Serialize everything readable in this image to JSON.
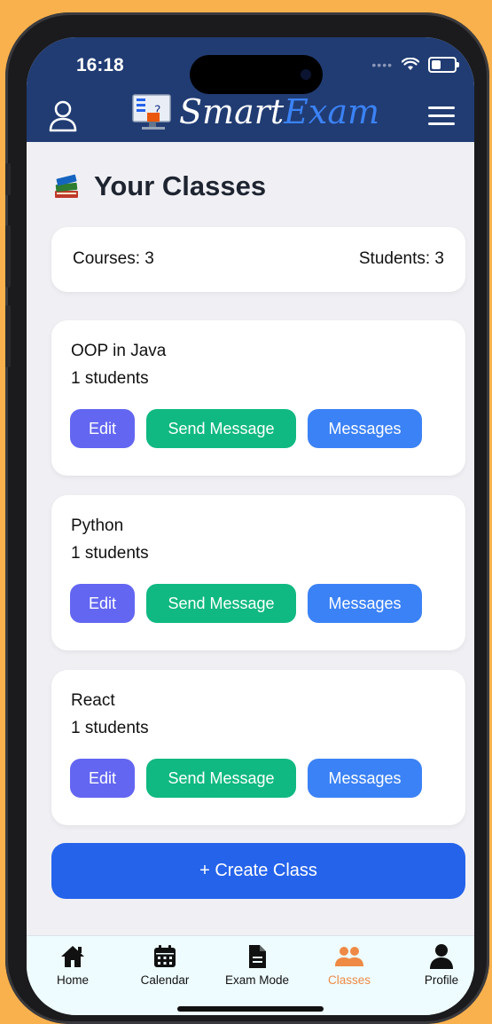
{
  "status_bar": {
    "time": "16:18"
  },
  "header": {
    "logo_primary": "Smart",
    "logo_secondary": "Exam",
    "user_icon": "user-icon",
    "menu_icon": "hamburger-menu-icon"
  },
  "page": {
    "title": "Your Classes",
    "title_icon": "books-icon"
  },
  "stats": {
    "courses": "Courses: 3",
    "students": "Students: 3"
  },
  "classes": [
    {
      "name": "OOP in Java",
      "count": "1 students",
      "edit": "Edit",
      "send": "Send Message",
      "messages": "Messages"
    },
    {
      "name": "Python",
      "count": "1 students",
      "edit": "Edit",
      "send": "Send Message",
      "messages": "Messages"
    },
    {
      "name": "React",
      "count": "1 students",
      "edit": "Edit",
      "send": "Send Message",
      "messages": "Messages"
    }
  ],
  "create_button": "+ Create Class",
  "tabs": [
    {
      "label": "Home",
      "icon": "home-icon"
    },
    {
      "label": "Calendar",
      "icon": "calendar-icon"
    },
    {
      "label": "Exam Mode",
      "icon": "document-icon"
    },
    {
      "label": "Classes",
      "icon": "group-icon",
      "active": true
    },
    {
      "label": "Profile",
      "icon": "person-icon"
    }
  ],
  "colors": {
    "header": "#213c73",
    "edit": "#6366f1",
    "send": "#10b981",
    "messages": "#3b82f6",
    "create": "#2563eb",
    "active_tab": "#ee8a45"
  }
}
